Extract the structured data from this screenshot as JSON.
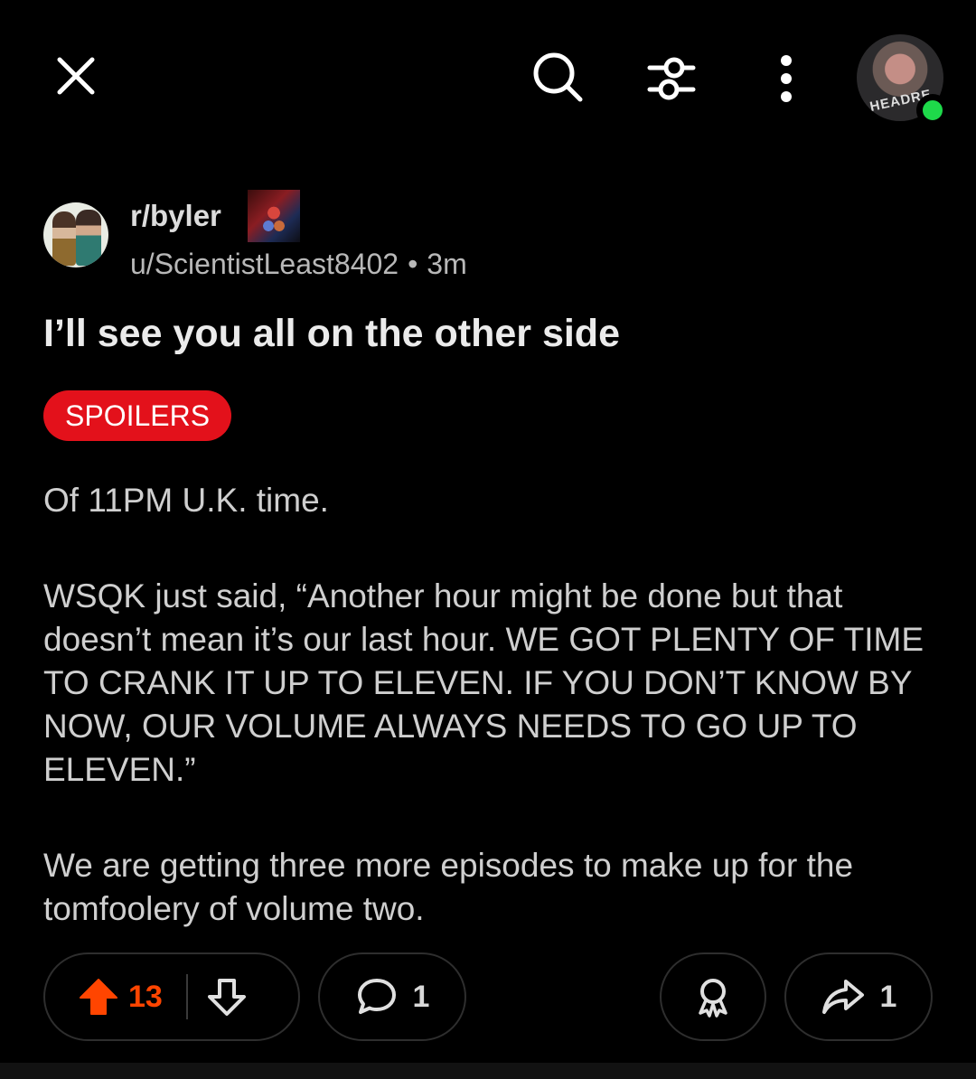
{
  "toolbar": {
    "close_icon": "close-icon",
    "search_icon": "search-icon",
    "filter_icon": "filter-icon",
    "more_icon": "more-vertical-icon",
    "avatar_text": "HEADRE",
    "online_color": "#1ed94a"
  },
  "post": {
    "subreddit": "r/byler",
    "author": "u/ScientistLeast8402",
    "separator": "•",
    "time": "3m",
    "title": "I’ll see you all on the other side",
    "flair": "SPOILERS",
    "flair_color": "#e3111b",
    "body": [
      "Of 11PM U.K. time.",
      "WSQK just said, “Another hour might be done but that doesn’t mean it’s our last hour. WE GOT PLENTY OF TIME TO CRANK IT UP TO ELEVEN. IF YOU DON’T KNOW BY NOW, OUR VOLUME ALWAYS NEEDS TO GO UP TO ELEVEN.”",
      "We are getting three more episodes to make up for the tomfoolery of volume two."
    ]
  },
  "actions": {
    "upvote_icon": "upvote-filled-icon",
    "upvote_count": "13",
    "upvote_color": "#ff4500",
    "downvote_icon": "downvote-icon",
    "comment_icon": "comment-icon",
    "comment_count": "1",
    "award_icon": "award-icon",
    "share_icon": "share-icon",
    "share_count": "1"
  }
}
